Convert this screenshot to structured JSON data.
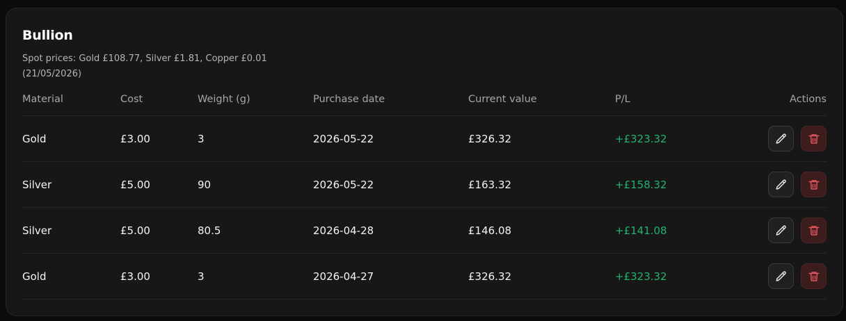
{
  "card": {
    "title": "Bullion",
    "spot_prices": "Spot prices: Gold £108.77, Silver £1.81, Copper £0.01 (21/05/2026)"
  },
  "table": {
    "columns": {
      "material": "Material",
      "cost": "Cost",
      "weight": "Weight (g)",
      "purchase_date": "Purchase date",
      "current_value": "Current value",
      "pl": "P/L",
      "actions": "Actions"
    },
    "rows": [
      {
        "material": "Gold",
        "cost": "£3.00",
        "weight": "3",
        "purchase_date": "2026-05-22",
        "current_value": "£326.32",
        "pl": "+£323.32"
      },
      {
        "material": "Silver",
        "cost": "£5.00",
        "weight": "90",
        "purchase_date": "2026-05-22",
        "current_value": "£163.32",
        "pl": "+£158.32"
      },
      {
        "material": "Silver",
        "cost": "£5.00",
        "weight": "80.5",
        "purchase_date": "2026-04-28",
        "current_value": "£146.08",
        "pl": "+£141.08"
      },
      {
        "material": "Gold",
        "cost": "£3.00",
        "weight": "3",
        "purchase_date": "2026-04-27",
        "current_value": "£326.32",
        "pl": "+£323.32"
      }
    ]
  },
  "icons": {
    "edit": "pencil-icon",
    "delete": "trash-icon"
  },
  "colors": {
    "background": "#0b0b0b",
    "card": "#171717",
    "profit": "#22b36e",
    "delete_accent": "#e0555c"
  }
}
